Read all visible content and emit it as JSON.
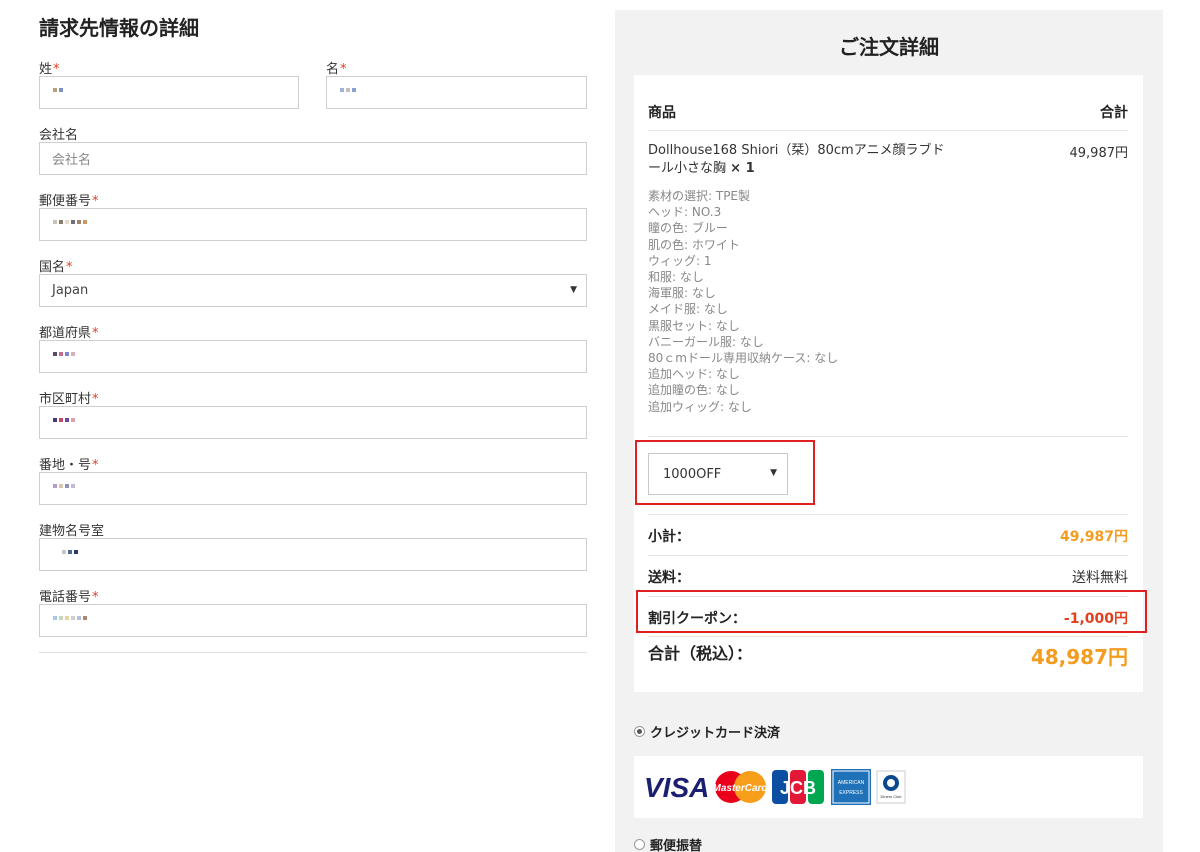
{
  "billing": {
    "title": "請求先情報の詳細",
    "fields": {
      "last_name": {
        "label": "姓"
      },
      "first_name": {
        "label": "名"
      },
      "company": {
        "label": "会社名",
        "placeholder": "会社名"
      },
      "postcode": {
        "label": "郵便番号"
      },
      "country": {
        "label": "国名",
        "value": "Japan"
      },
      "state": {
        "label": "都道府県"
      },
      "city": {
        "label": "市区町村"
      },
      "address1": {
        "label": "番地・号"
      },
      "address2": {
        "label": "建物名号室"
      },
      "phone": {
        "label": "電話番号"
      }
    },
    "required_mark": "*"
  },
  "order": {
    "title": "ご注文詳細",
    "header": {
      "product": "商品",
      "total": "合計"
    },
    "item": {
      "name": "Dollhouse168 Shiori（栞）80cmアニメ顔ラブドール小さな胸",
      "qty": "× 1",
      "price": "49,987円",
      "options": [
        "素材の選択: TPE製",
        "ヘッド: NO.3",
        "瞳の色: ブルー",
        "肌の色: ホワイト",
        "ウィッグ: 1",
        "和服: なし",
        "海軍服: なし",
        "メイド服: なし",
        "黒服セット: なし",
        "バニーガール服: なし",
        "80ｃmドール専用収納ケース: なし",
        "追加ヘッド: なし",
        "追加瞳の色: なし",
        "追加ウィッグ: なし"
      ]
    },
    "coupon_select": "1000OFF",
    "subtotal": {
      "label": "小計：",
      "value": "49,987円"
    },
    "shipping": {
      "label": "送料：",
      "value": "送料無料"
    },
    "discount": {
      "label": "割引クーポン：",
      "value": "-1,000円"
    },
    "grand_total": {
      "label": "合計（税込）：",
      "value": "48,987円"
    }
  },
  "payment": {
    "credit_card": "クレジットカード決済",
    "postal_transfer": "郵便振替",
    "card_logos": [
      "VISA",
      "MasterCard",
      "JCB",
      "AMERICAN EXPRESS",
      "Diners Club International"
    ]
  },
  "colors": {
    "accent_orange": "#f39c1f",
    "required_red": "#e2401c",
    "highlight_box": "#e02020",
    "panel_bg": "#f2f2f2"
  }
}
